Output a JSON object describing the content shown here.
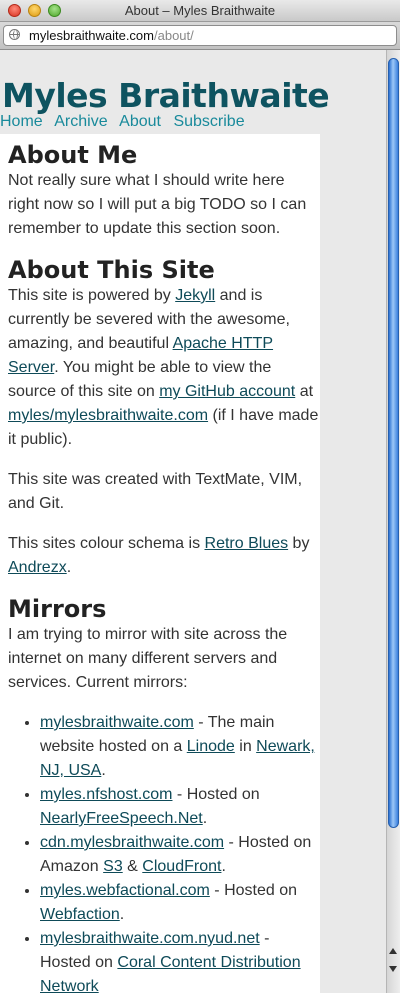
{
  "window": {
    "title": "About – Myles Braithwaite"
  },
  "address": {
    "host": "mylesbraithwaite.com",
    "path": "/about/"
  },
  "site": {
    "title": "Myles Braithwaite",
    "nav": [
      "Home",
      "Archive",
      "About",
      "Subscribe"
    ]
  },
  "about_me": {
    "heading": "About Me",
    "text": "Not really sure what I should write here right now so I will put a big TODO so I can remember to update this section soon."
  },
  "about_site": {
    "heading": "About This Site",
    "p1": {
      "t1": "This site is powered by ",
      "l1": "Jekyll",
      "t2": " and is currently be severed with the awesome, amazing, and beautiful ",
      "l2": "Apache HTTP Server",
      "t3": ". You might be able to view the source of this site on ",
      "l3": "my GitHub account",
      "t4": " at ",
      "l4": "myles/mylesbraithwaite.com",
      "t5": " (if I have made it public)."
    },
    "p2": "This site was created with TextMate, VIM, and Git.",
    "p3": {
      "t1": "This sites colour schema is ",
      "l1": "Retro Blues",
      "t2": " by ",
      "l2": "Andrezx",
      "t3": "."
    }
  },
  "mirrors": {
    "heading": "Mirrors",
    "intro": "I am trying to mirror with site across the internet on many different servers and services. Current mirrors:",
    "items": [
      {
        "l1": "mylesbraithwaite.com",
        "t1": " - The main website hosted on a ",
        "l2": "Linode",
        "t2": " in ",
        "l3": "Newark, NJ, USA",
        "t3": "."
      },
      {
        "l1": "myles.nfshost.com",
        "t1": " - Hosted on ",
        "l2": "NearlyFreeSpeech.Net",
        "t2": "."
      },
      {
        "l1": "cdn.mylesbraithwaite.com",
        "t1": " - Hosted on Amazon ",
        "l2": "S3",
        "t2": " & ",
        "l3": "CloudFront",
        "t3": "."
      },
      {
        "l1": "myles.webfactional.com",
        "t1": " - Hosted on ",
        "l2": "Webfaction",
        "t2": "."
      },
      {
        "l1": "mylesbraithwaite.com.nyud.net",
        "t1": " - Hosted on ",
        "l2": "Coral Content Distribution Network",
        "t2": ""
      }
    ]
  }
}
